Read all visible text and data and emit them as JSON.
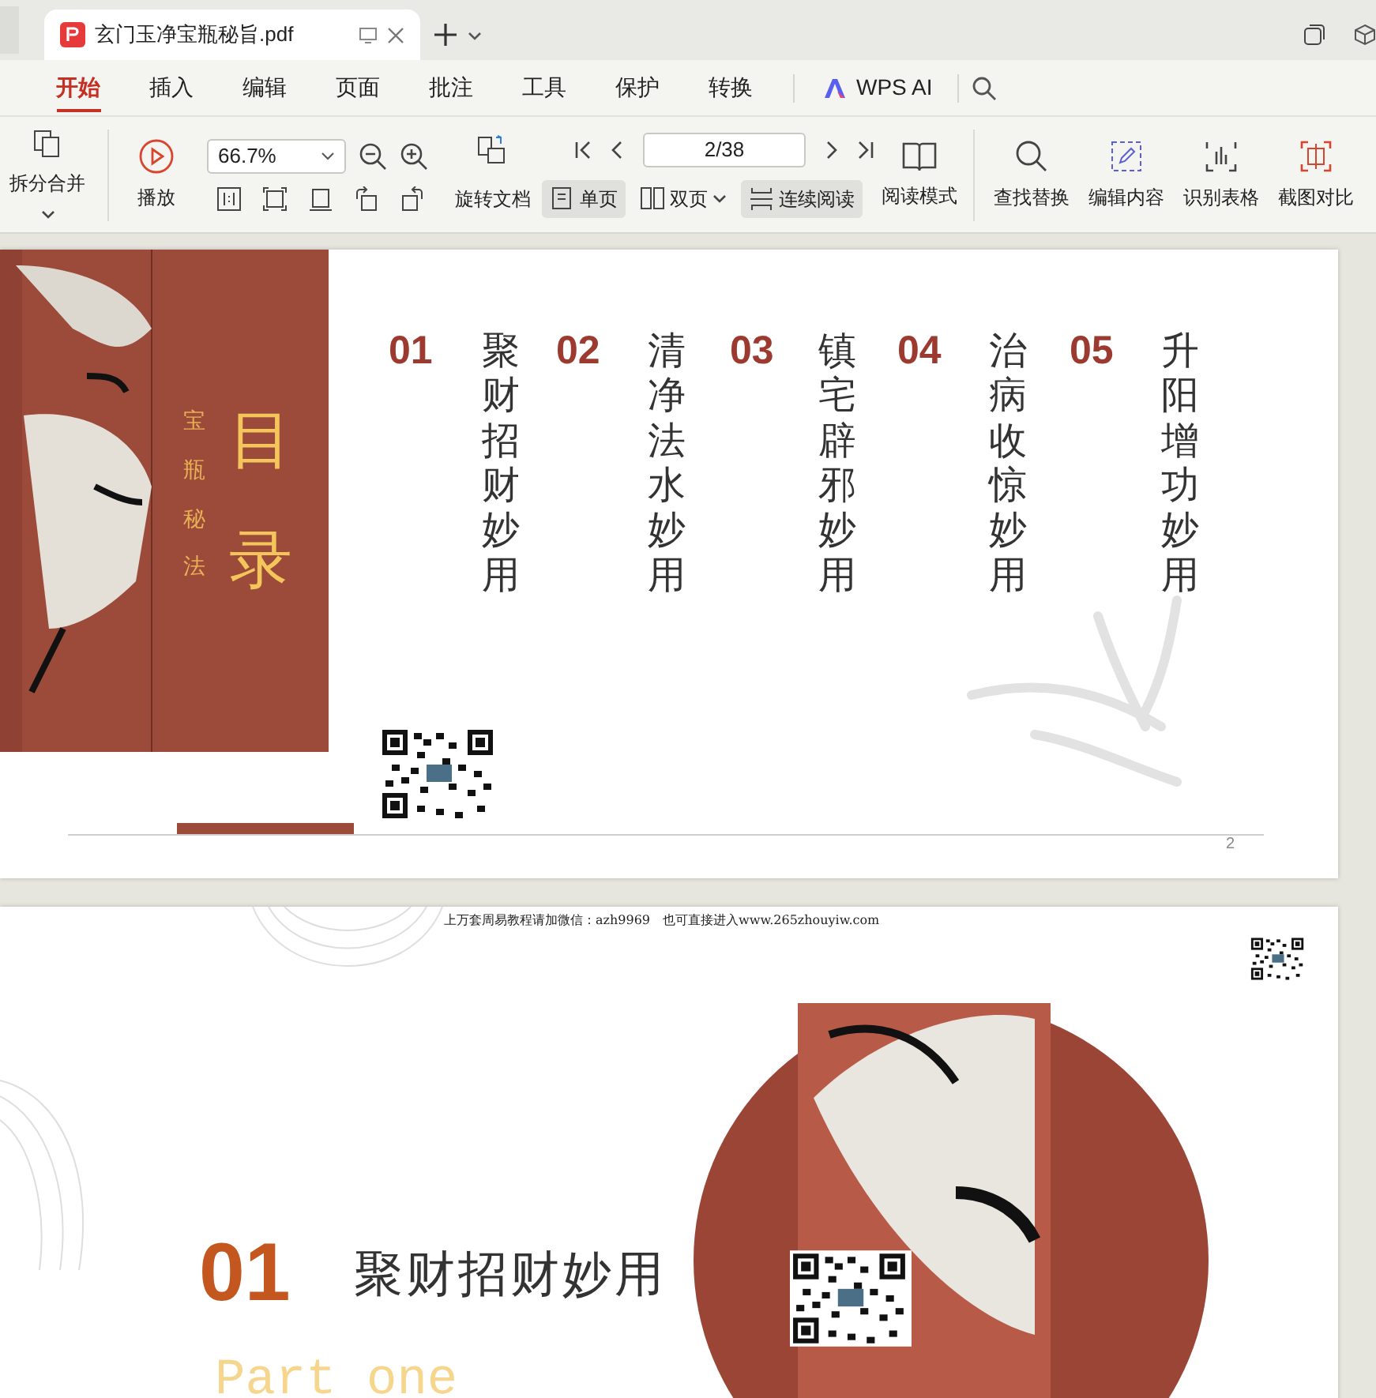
{
  "document_tab": {
    "title": "玄门玉净宝瓶秘旨.pdf",
    "selected": true
  },
  "ribbon_tabs": [
    {
      "label": "开始",
      "selected": true
    },
    {
      "label": "插入",
      "selected": false
    },
    {
      "label": "编辑",
      "selected": false
    },
    {
      "label": "页面",
      "selected": false
    },
    {
      "label": "批注",
      "selected": false
    },
    {
      "label": "工具",
      "selected": false
    },
    {
      "label": "保护",
      "selected": false
    },
    {
      "label": "转换",
      "selected": false
    }
  ],
  "ai_tab": "WPS AI",
  "toolbar": {
    "split_merge": "拆分合并",
    "play": "播放",
    "zoom": "66.7%",
    "page_field": "2/38",
    "rotate": "旋转文档",
    "view_modes": [
      {
        "kind": "single",
        "label": "单页",
        "selected": true
      },
      {
        "kind": "double",
        "label": "双页",
        "selected": false
      },
      {
        "kind": "continuous",
        "label": "连续阅读",
        "selected": true
      }
    ],
    "reading_mode": "阅读模式",
    "tools": [
      {
        "kind": "search",
        "label": "查找替换"
      },
      {
        "kind": "edit",
        "label": "编辑内容"
      },
      {
        "kind": "table",
        "label": "识别表格"
      },
      {
        "kind": "compare",
        "label": "截图对比"
      }
    ]
  },
  "page_1": {
    "heading": "目录",
    "subheading": "宝瓶秘法",
    "contents": [
      {
        "number": "01",
        "title": "聚财招财妙用"
      },
      {
        "number": "02",
        "title": "清净法水妙用"
      },
      {
        "number": "03",
        "title": "镇宅辟邪妙用"
      },
      {
        "number": "04",
        "title": "治病收惊妙用"
      },
      {
        "number": "05",
        "title": "升阳增功妙用"
      }
    ],
    "page_number": "2"
  },
  "page_2": {
    "header_note": "上万套周易教程请加微信：azh9969　也可直接进入www.265zhouyiw.com",
    "number": "01",
    "title": "聚财招财妙用",
    "subtitle": "Part one"
  }
}
